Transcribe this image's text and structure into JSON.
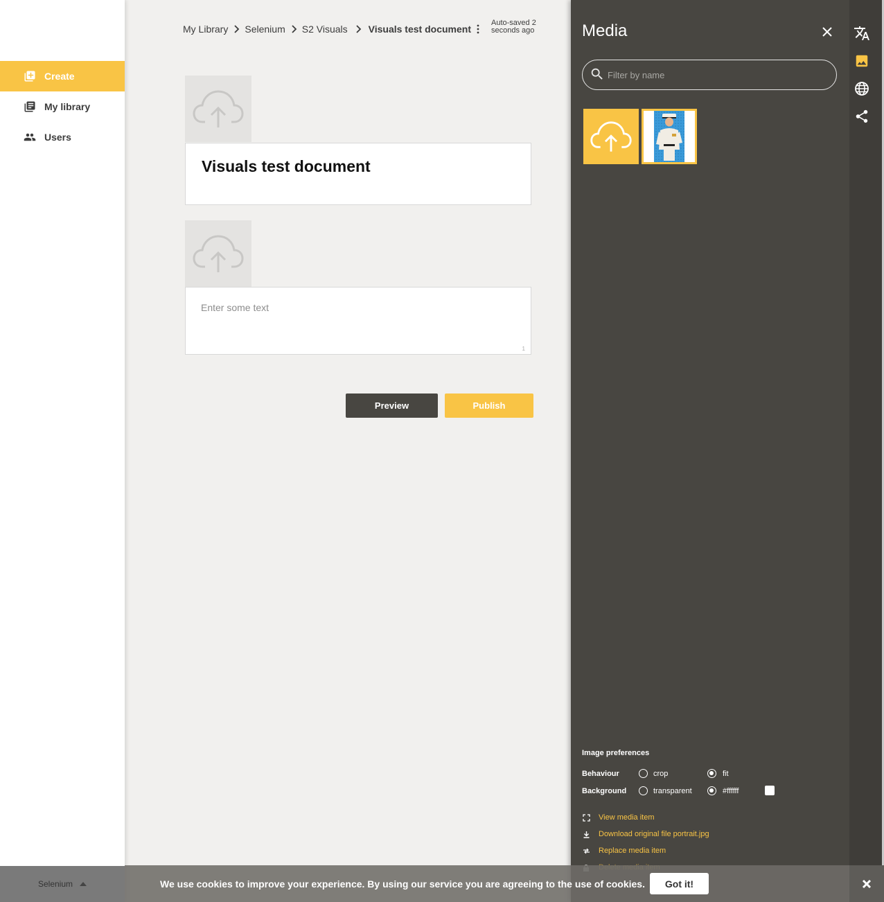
{
  "sidebar": {
    "items": [
      {
        "label": "Create",
        "icon": "add-box-icon",
        "active": true
      },
      {
        "label": "My library",
        "icon": "library-icon",
        "active": false
      },
      {
        "label": "Users",
        "icon": "users-icon",
        "active": false
      }
    ],
    "footer_label": "Selenium"
  },
  "breadcrumb": {
    "items": [
      "My Library",
      "Selenium",
      "S2 Visuals"
    ],
    "current": "Visuals test document",
    "autosave": "Auto-saved 2 seconds ago"
  },
  "editor": {
    "title": "Visuals test document",
    "text_placeholder": "Enter some text",
    "char_count": "1",
    "preview_label": "Preview",
    "publish_label": "Publish"
  },
  "media": {
    "title": "Media",
    "filter_placeholder": "Filter by name",
    "image_preferences_title": "Image preferences",
    "behaviour_label": "Behaviour",
    "behaviour_options": [
      "crop",
      "fit"
    ],
    "behaviour_selected": "fit",
    "background_label": "Background",
    "background_options": [
      "transparent",
      "#ffffff"
    ],
    "background_selected": "#ffffff",
    "actions": [
      {
        "label": "View media item",
        "icon": "fullscreen-icon"
      },
      {
        "label": "Download original file portrait.jpg",
        "icon": "download-icon"
      },
      {
        "label": "Replace media item",
        "icon": "replace-icon"
      },
      {
        "label": "Delete media item",
        "icon": "lock-icon"
      }
    ]
  },
  "cookie": {
    "text": "We use cookies to improve your experience. By using our service you are agreeing to the use of cookies.",
    "button": "Got it!"
  },
  "colors": {
    "accent": "#f9c445",
    "panel": "#484641",
    "background": "#f1f0ee"
  }
}
